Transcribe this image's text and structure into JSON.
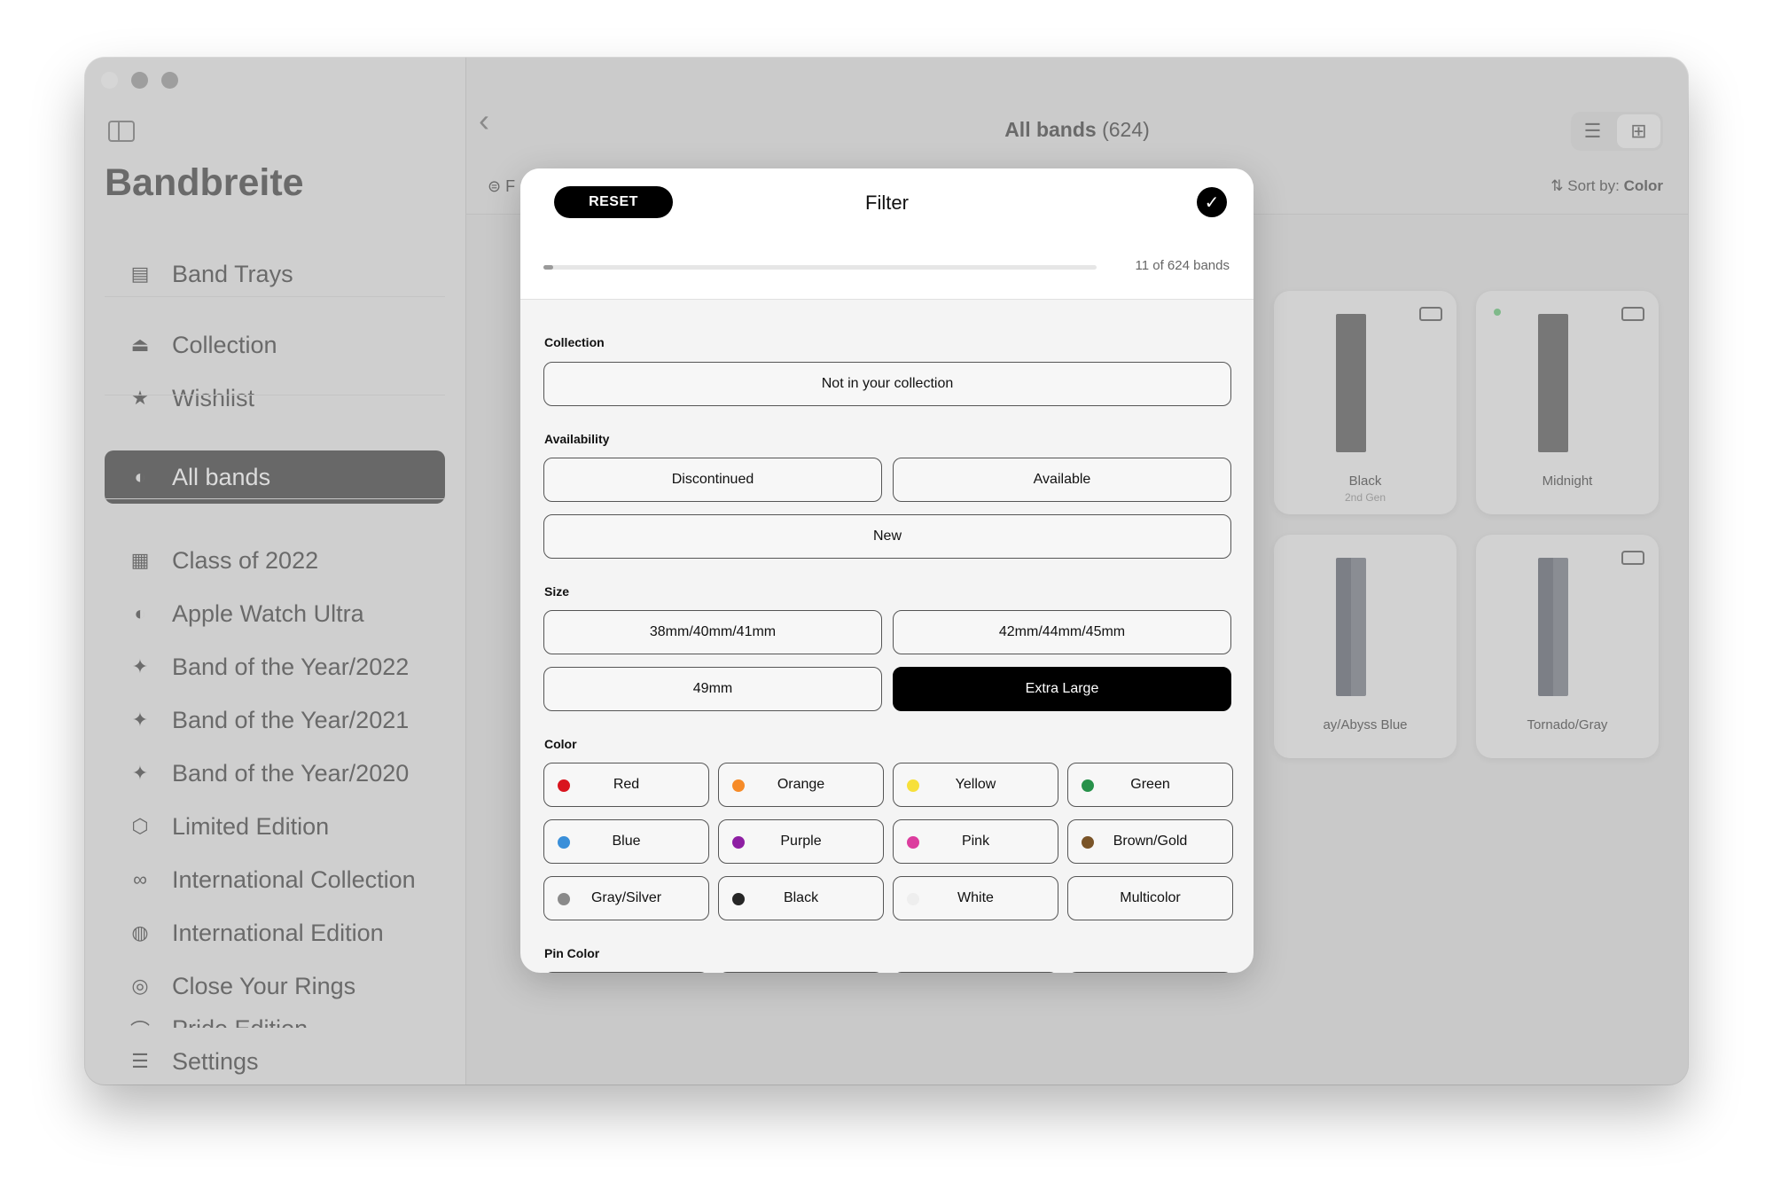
{
  "window": {
    "traffic_lights": [
      "close",
      "minimize",
      "zoom"
    ]
  },
  "sidebar": {
    "app_title": "Bandbreite",
    "toggle_icon": "sidebar-toggle-icon",
    "items": [
      {
        "label": "Band Trays",
        "icon": "tray-stack-icon",
        "glyph": "▤",
        "active": false
      },
      {
        "label": "Collection",
        "icon": "tray-icon",
        "glyph": "⏏",
        "active": false
      },
      {
        "label": "Wishlist",
        "icon": "star-icon",
        "glyph": "★",
        "active": false
      },
      {
        "label": "All bands",
        "icon": "watch-icon",
        "glyph": "◐",
        "active": true
      },
      {
        "label": "Class of 2022",
        "icon": "calendar-icon",
        "glyph": "▦",
        "active": false
      },
      {
        "label": "Apple Watch Ultra",
        "icon": "watch-icon",
        "glyph": "◐",
        "active": false
      },
      {
        "label": "Band of the Year/2022",
        "icon": "sparkles-icon",
        "glyph": "✦",
        "active": false
      },
      {
        "label": "Band of the Year/2021",
        "icon": "sparkles-icon",
        "glyph": "✦",
        "active": false
      },
      {
        "label": "Band of the Year/2020",
        "icon": "sparkles-icon",
        "glyph": "✦",
        "active": false
      },
      {
        "label": "Limited Edition",
        "icon": "box-icon",
        "glyph": "⬡",
        "active": false
      },
      {
        "label": "International Collection",
        "icon": "olympic-rings-icon",
        "glyph": "∞",
        "active": false
      },
      {
        "label": "International Edition",
        "icon": "globe-icon",
        "glyph": "◍",
        "active": false
      },
      {
        "label": "Close Your Rings",
        "icon": "rings-icon",
        "glyph": "◎",
        "active": false
      },
      {
        "label": "Pride Edition",
        "icon": "rainbow-icon",
        "glyph": "⌒",
        "active": false
      },
      {
        "label": "Settings",
        "icon": "toggles-icon",
        "glyph": "☰",
        "active": false
      }
    ]
  },
  "header": {
    "title": "All bands",
    "count": "(624)",
    "back_icon": "chevron-left-icon",
    "view_modes": [
      {
        "icon": "list-icon",
        "glyph": "☰",
        "selected": false
      },
      {
        "icon": "grid-icon",
        "glyph": "⊞",
        "selected": true
      }
    ],
    "filter_label": "F",
    "sort_label": "Sort by:",
    "sort_value": "Color"
  },
  "cards": [
    {
      "name": "Black",
      "sub": "2nd Gen",
      "in_collection": true,
      "new_dot": false,
      "style": "sport"
    },
    {
      "name": "Midnight",
      "sub": "",
      "in_collection": true,
      "new_dot": true,
      "style": "sport"
    },
    {
      "name": "ay/Abyss Blue",
      "sub": "",
      "in_collection": false,
      "new_dot": false,
      "style": "loop"
    },
    {
      "name": "Tornado/Gray",
      "sub": "",
      "in_collection": true,
      "new_dot": false,
      "style": "loop"
    }
  ],
  "filter": {
    "reset_label": "RESET",
    "title": "Filter",
    "done_icon": "checkmark-icon",
    "matched": 11,
    "total": 624,
    "count_text": "11 of 624 bands",
    "progress_fraction": 0.0176,
    "sections": {
      "collection": {
        "label": "Collection",
        "options": [
          {
            "label": "Not in your collection",
            "selected": false
          }
        ]
      },
      "availability": {
        "label": "Availability",
        "options": [
          {
            "label": "Discontinued",
            "selected": false
          },
          {
            "label": "Available",
            "selected": false
          },
          {
            "label": "New",
            "selected": false
          }
        ]
      },
      "size": {
        "label": "Size",
        "options": [
          {
            "label": "38mm/40mm/41mm",
            "selected": false
          },
          {
            "label": "42mm/44mm/45mm",
            "selected": false
          },
          {
            "label": "49mm",
            "selected": false
          },
          {
            "label": "Extra Large",
            "selected": true
          }
        ]
      },
      "color": {
        "label": "Color",
        "options": [
          {
            "label": "Red",
            "swatch": "#d9141e",
            "selected": false
          },
          {
            "label": "Orange",
            "swatch": "#f68b28",
            "selected": false
          },
          {
            "label": "Yellow",
            "swatch": "#f7e03a",
            "selected": false
          },
          {
            "label": "Green",
            "swatch": "#27914a",
            "selected": false
          },
          {
            "label": "Blue",
            "swatch": "#3a8fd9",
            "selected": false
          },
          {
            "label": "Purple",
            "swatch": "#8e1fa3",
            "selected": false
          },
          {
            "label": "Pink",
            "swatch": "#dc3d9e",
            "selected": false
          },
          {
            "label": "Brown/Gold",
            "swatch": "#7a5428",
            "selected": false
          },
          {
            "label": "Gray/Silver",
            "swatch": "#8a8a8a",
            "selected": false
          },
          {
            "label": "Black",
            "swatch": "#262626",
            "selected": false
          },
          {
            "label": "White",
            "swatch": "#eeeeee",
            "selected": false
          },
          {
            "label": "Multicolor",
            "swatch": null,
            "selected": false
          }
        ]
      },
      "pin_color": {
        "label": "Pin Color"
      }
    }
  }
}
